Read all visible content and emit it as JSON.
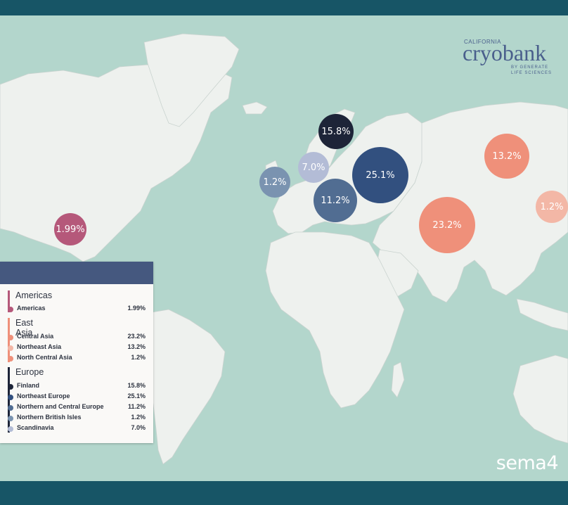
{
  "logo": {
    "top": "CALIFORNIA",
    "main": "cryobank",
    "sub1": "BY GENERATE",
    "sub2": "LIFE SCIENCES"
  },
  "brand": "sema4",
  "colors": {
    "ocean": "#b3d6cc",
    "land": "#eef1ee",
    "bar": "#175566",
    "legend_header": "#45587f"
  },
  "regions": [
    {
      "id": "americas",
      "label": "1.99%",
      "color": "#b5587a"
    },
    {
      "id": "finland",
      "label": "15.8%",
      "color": "#1d2438"
    },
    {
      "id": "scandinavia",
      "label": "7.0%",
      "color": "#b3bcd6"
    },
    {
      "id": "northern-british-isles",
      "label": "1.2%",
      "color": "#7a93b0"
    },
    {
      "id": "northeast-europe",
      "label": "25.1%",
      "color": "#32507f"
    },
    {
      "id": "northern-central-europe",
      "label": "11.2%",
      "color": "#516d92"
    },
    {
      "id": "northeast-asia",
      "label": "13.2%",
      "color": "#ef907a"
    },
    {
      "id": "central-asia",
      "label": "23.2%",
      "color": "#ef907a"
    },
    {
      "id": "north-central-asia",
      "label": "1.2%",
      "color": "#f3b7a6"
    }
  ],
  "legend": {
    "groups": [
      {
        "title": "Americas",
        "color": "#b5587a",
        "items": [
          {
            "name": "Americas",
            "value": "1.99%",
            "color": "#b5587a"
          }
        ]
      },
      {
        "title": "East Asia",
        "color": "#ef907a",
        "items": [
          {
            "name": "Central Asia",
            "value": "23.2%",
            "color": "#ef907a"
          },
          {
            "name": "Northeast Asia",
            "value": "13.2%",
            "color": "#f3b7a6"
          },
          {
            "name": "North Central Asia",
            "value": "1.2%",
            "color": "#ef907a"
          }
        ]
      },
      {
        "title": "Europe",
        "color": "#1d2438",
        "items": [
          {
            "name": "Finland",
            "value": "15.8%",
            "color": "#1d2438"
          },
          {
            "name": "Northeast Europe",
            "value": "25.1%",
            "color": "#32507f"
          },
          {
            "name": "Northern and Central Europe",
            "value": "11.2%",
            "color": "#516d92"
          },
          {
            "name": "Northern British Isles",
            "value": "1.2%",
            "color": "#7a93b0"
          },
          {
            "name": "Scandinavia",
            "value": "7.0%",
            "color": "#b3bcd6"
          }
        ]
      }
    ]
  }
}
